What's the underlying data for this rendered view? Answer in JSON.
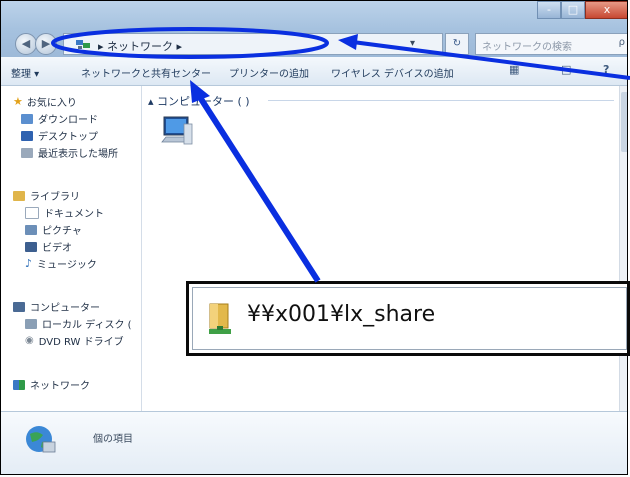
{
  "window": {
    "controls": {
      "minimize": "-",
      "maximize": "□",
      "close": "x"
    },
    "nav": {
      "back_icon": "back-arrow-icon",
      "forward_icon": "forward-arrow-icon"
    },
    "address": {
      "crumb": "▸ ネットワーク ▸",
      "dropdown": "▾",
      "refresh": "↻"
    },
    "search": {
      "placeholder": "ネットワークの検索",
      "icon": "ρ"
    }
  },
  "toolbar": {
    "organize": "整理 ▾",
    "network_center": "ネットワークと共有センター",
    "add_printer": "プリンターの追加",
    "add_wireless": "ワイヤレス デバイスの追加",
    "view_icon": "▦",
    "pane_icon": "□",
    "help_icon": "?"
  },
  "sidebar": {
    "favorites": "お気に入り",
    "downloads": "ダウンロード",
    "desktop": "デスクトップ",
    "recent": "最近表示した場所",
    "libraries": "ライブラリ",
    "documents": "ドキュメント",
    "pictures": "ピクチャ",
    "videos": "ビデオ",
    "music": "ミュージック",
    "computer": "コンピューター",
    "local_disk": "ローカル ディスク (",
    "dvd": "DVD RW ドライブ",
    "network": "ネットワーク"
  },
  "content": {
    "group_header": "▴ コンピューター (  )"
  },
  "status": {
    "text": "個の項目"
  },
  "callout": {
    "path": "¥¥x001¥lx_share"
  },
  "colors": {
    "annotation_blue": "#0a2fe0"
  }
}
